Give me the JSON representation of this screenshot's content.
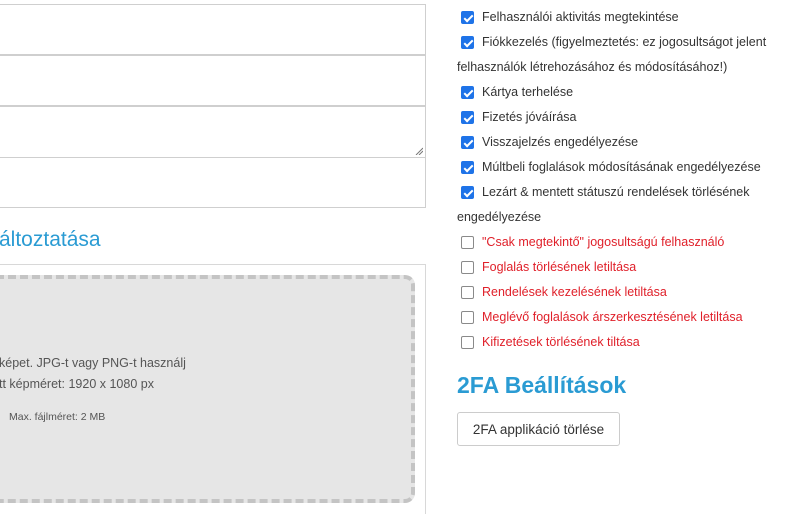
{
  "form": {
    "section_title": "áltoztatása"
  },
  "upload": {
    "line1": "képet. JPG-t vagy PNG-t használj",
    "line2": "tt képméret: 1920 x 1080 px",
    "max_size": "Max. fájlméret: 2 MB"
  },
  "permissions": [
    {
      "label": "Felhasználói aktivitás megtekintése",
      "checked": true,
      "danger": false
    },
    {
      "label": "Fiókkezelés (figyelmeztetés: ez jogosultságot jelent",
      "label2": "felhasználók létrehozásához és módosításához!)",
      "checked": true,
      "danger": false
    },
    {
      "label": "Kártya terhelése",
      "checked": true,
      "danger": false
    },
    {
      "label": "Fizetés jóváírása",
      "checked": true,
      "danger": false
    },
    {
      "label": "Visszajelzés engedélyezése",
      "checked": true,
      "danger": false
    },
    {
      "label": "Múltbeli foglalások módosításának engedélyezése",
      "checked": true,
      "danger": false
    },
    {
      "label": "Lezárt & mentett státuszú rendelések törlésének",
      "label2": "engedélyezése",
      "checked": true,
      "danger": false
    },
    {
      "label": "\"Csak megtekintő\" jogosultságú felhasználó",
      "checked": false,
      "danger": true
    },
    {
      "label": "Foglalás törlésének letiltása",
      "checked": false,
      "danger": true
    },
    {
      "label": "Rendelések kezelésének letiltása",
      "checked": false,
      "danger": true
    },
    {
      "label": "Meglévő foglalások árszerkesztésének letiltása",
      "checked": false,
      "danger": true
    },
    {
      "label": "Kifizetések törlésének tiltása",
      "checked": false,
      "danger": true
    }
  ],
  "twofa": {
    "title": "2FA Beállítások",
    "button_label": "2FA applikáció törlése"
  },
  "colors": {
    "accent": "#2a9bd3",
    "checkbox": "#1e73e8",
    "danger": "#e0202a"
  }
}
